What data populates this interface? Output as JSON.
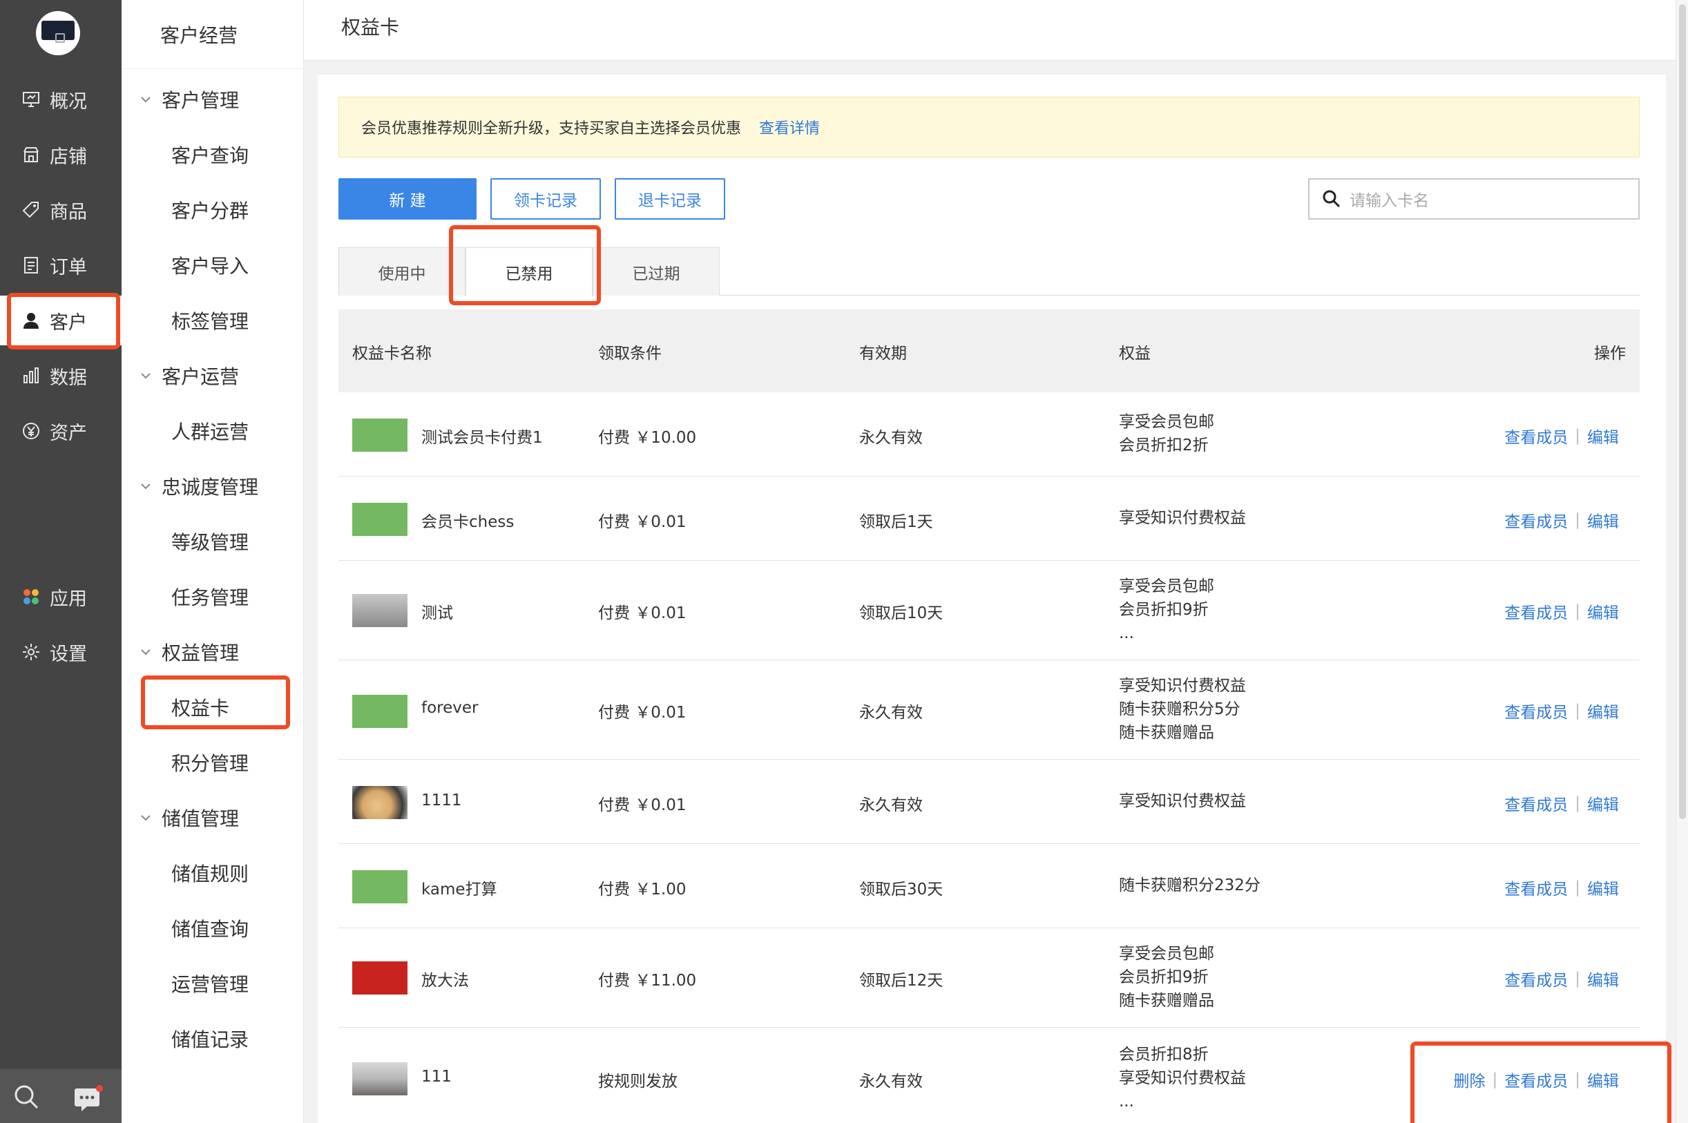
{
  "nav_primary": {
    "items": [
      {
        "label": "概况",
        "icon": "monitor-icon"
      },
      {
        "label": "店铺",
        "icon": "store-icon"
      },
      {
        "label": "商品",
        "icon": "tag-icon"
      },
      {
        "label": "订单",
        "icon": "order-list-icon"
      },
      {
        "label": "客户",
        "icon": "user-icon",
        "active": true
      },
      {
        "label": "数据",
        "icon": "bar-chart-icon"
      },
      {
        "label": "资产",
        "icon": "yuan-icon"
      },
      {
        "label": "应用",
        "icon": "apps-icon"
      },
      {
        "label": "设置",
        "icon": "gear-icon"
      }
    ]
  },
  "nav_secondary": {
    "title": "客户经营",
    "groups": [
      {
        "label": "客户管理",
        "items": [
          "客户查询",
          "客户分群",
          "客户导入",
          "标签管理"
        ]
      },
      {
        "label": "客户运营",
        "items": [
          "人群运营"
        ]
      },
      {
        "label": "忠诚度管理",
        "items": [
          "等级管理",
          "任务管理"
        ]
      },
      {
        "label": "权益管理",
        "items": [
          "权益卡",
          "积分管理"
        ]
      },
      {
        "label": "储值管理",
        "items": [
          "储值规则",
          "储值查询",
          "运营管理",
          "储值记录"
        ]
      }
    ]
  },
  "page": {
    "title": "权益卡",
    "notice": {
      "text": "会员优惠推荐规则全新升级，支持买家自主选择会员优惠",
      "link": "查看详情"
    },
    "buttons": {
      "new": "新 建",
      "claim_records": "领卡记录",
      "return_records": "退卡记录"
    },
    "search": {
      "placeholder": "请输入卡名"
    },
    "tabs": [
      "使用中",
      "已禁用",
      "已过期"
    ],
    "active_tab": "已禁用",
    "columns": [
      "权益卡名称",
      "领取条件",
      "有效期",
      "权益",
      "操作"
    ]
  },
  "table": {
    "rows": [
      {
        "name": "测试会员卡付费1",
        "thumb": "green",
        "condition": "付费 ￥10.00",
        "validity": "永久有效",
        "rights": [
          "享受会员包邮",
          "会员折扣2折"
        ],
        "ops": [
          "查看成员",
          "编辑"
        ]
      },
      {
        "name": "会员卡chess",
        "thumb": "green",
        "condition": "付费 ￥0.01",
        "validity": "领取后1天",
        "rights": [
          "享受知识付费权益"
        ],
        "ops": [
          "查看成员",
          "编辑"
        ]
      },
      {
        "name": "测试",
        "thumb": "photo-desk",
        "condition": "付费 ￥0.01",
        "validity": "领取后10天",
        "rights": [
          "享受会员包邮",
          "会员折扣9折",
          "..."
        ],
        "ops": [
          "查看成员",
          "编辑"
        ]
      },
      {
        "name": "forever",
        "thumb": "green",
        "condition": "付费 ￥0.01",
        "validity": "永久有效",
        "rights": [
          "享受知识付费权益",
          "随卡获赠积分5分",
          "随卡获赠赠品"
        ],
        "ops": [
          "查看成员",
          "编辑"
        ]
      },
      {
        "name": "1111",
        "thumb": "photo-dog",
        "condition": "付费 ￥0.01",
        "validity": "永久有效",
        "rights": [
          "享受知识付费权益"
        ],
        "ops": [
          "查看成员",
          "编辑"
        ]
      },
      {
        "name": "kame打算",
        "thumb": "green",
        "condition": "付费 ￥1.00",
        "validity": "领取后30天",
        "rights": [
          "随卡获赠积分232分"
        ],
        "ops": [
          "查看成员",
          "编辑"
        ]
      },
      {
        "name": "放大法",
        "thumb": "photo-red",
        "condition": "付费 ￥11.00",
        "validity": "领取后12天",
        "rights": [
          "享受会员包邮",
          "会员折扣9折",
          "随卡获赠赠品"
        ],
        "ops": [
          "查看成员",
          "编辑"
        ]
      },
      {
        "name": "111",
        "thumb": "photo-street",
        "condition": "按规则发放",
        "validity": "永久有效",
        "rights": [
          "会员折扣8折",
          "享受知识付费权益",
          "..."
        ],
        "ops": [
          "删除",
          "查看成员",
          "编辑"
        ]
      }
    ]
  },
  "colors": {
    "accent": "#3a86e6",
    "link": "#2f78d6",
    "highlight": "#ef4b24",
    "sidebar": "#444444",
    "notice_bg": "#fff9dc"
  }
}
